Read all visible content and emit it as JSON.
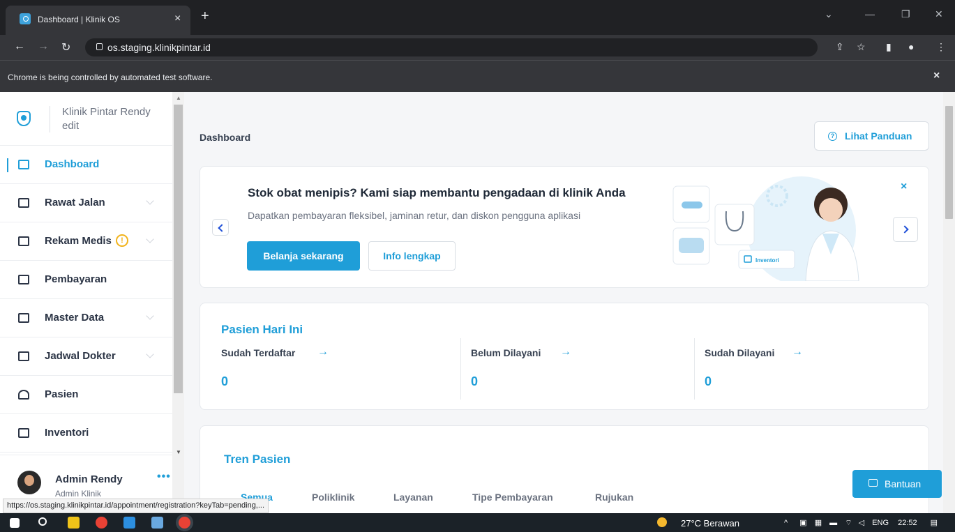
{
  "browser": {
    "tab_title": "Dashboard | Klinik OS",
    "tab_close": "×",
    "new_tab": "+",
    "url": "os.staging.klinikpintar.id",
    "automation_notice": "Chrome is being controlled by automated test software.",
    "notice_close": "×",
    "status_url": "https://os.staging.klinikpintar.id/appointment/registration?keyTab=pending,..."
  },
  "sidebar": {
    "clinic_name": "Klinik Pintar Rendy edit",
    "items": [
      {
        "label": "Dashboard",
        "icon": "dashboard-icon",
        "active": true,
        "expandable": false
      },
      {
        "label": "Rawat Jalan",
        "icon": "outpatient-icon",
        "active": false,
        "expandable": true
      },
      {
        "label": "Rekam Medis",
        "icon": "medical-record-icon",
        "active": false,
        "expandable": true,
        "warning": "!"
      },
      {
        "label": "Pembayaran",
        "icon": "payment-icon",
        "active": false,
        "expandable": false
      },
      {
        "label": "Master Data",
        "icon": "master-data-icon",
        "active": false,
        "expandable": true
      },
      {
        "label": "Jadwal Dokter",
        "icon": "calendar-icon",
        "active": false,
        "expandable": true
      },
      {
        "label": "Pasien",
        "icon": "person-icon",
        "active": false,
        "expandable": false
      },
      {
        "label": "Inventori",
        "icon": "inventory-icon",
        "active": false,
        "expandable": false
      }
    ],
    "user": {
      "name": "Admin Rendy",
      "role": "Admin Klinik",
      "more": "•••"
    }
  },
  "main": {
    "page_title": "Dashboard",
    "guide_button": "Lihat Panduan",
    "promo": {
      "heading": "Stok obat menipis? Kami siap membantu pengadaan di klinik Anda",
      "subtitle": "Dapatkan pembayaran fleksibel, jaminan retur, dan diskon pengguna aplikasi",
      "primary_button": "Belanja sekarang",
      "secondary_button": "Info lengkap",
      "close": "×",
      "illustration_tag": "Inventori"
    },
    "today": {
      "heading": "Pasien Hari Ini",
      "stats": [
        {
          "label": "Sudah Terdaftar",
          "value": "0"
        },
        {
          "label": "Belum Dilayani",
          "value": "0"
        },
        {
          "label": "Sudah Dilayani",
          "value": "0"
        }
      ],
      "arrow": "→"
    },
    "trend": {
      "heading": "Tren Pasien",
      "tabs": [
        "Semua",
        "Poliklinik",
        "Layanan",
        "Tipe Pembayaran",
        "Rujukan"
      ],
      "active_tab": "Semua"
    },
    "help_button": "Bantuan"
  },
  "taskbar": {
    "weather": "27°C Berawan",
    "language": "ENG",
    "time": "22:52"
  },
  "colors": {
    "accent": "#1f9ed8",
    "warning": "#f2b31b",
    "text_dark": "#2b3445"
  }
}
